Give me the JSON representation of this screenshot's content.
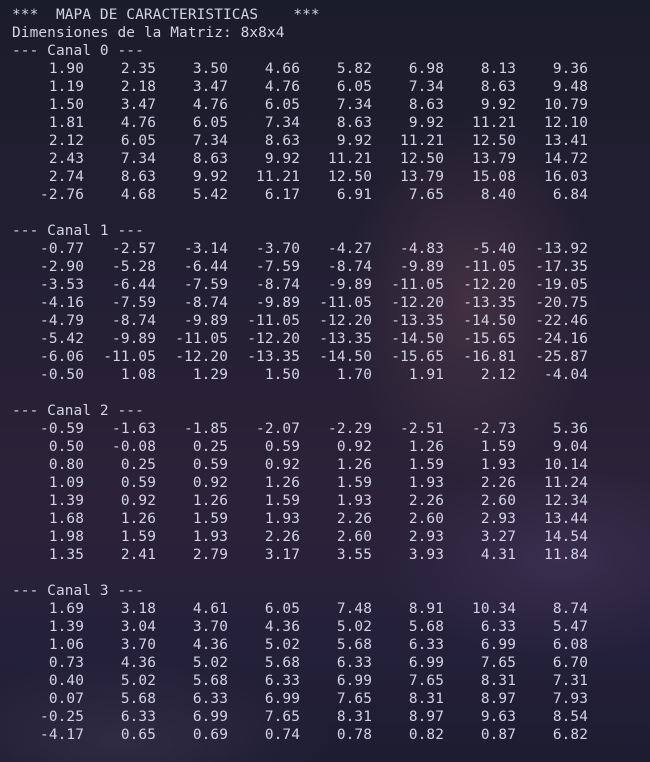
{
  "header": {
    "title_line": "***  MAPA DE CARACTERISTICAS    ***",
    "dims_line": "Dimensiones de la Matriz: 8x8x4"
  },
  "channels": [
    {
      "label": "--- Canal 0 ---",
      "rows": [
        [
          "1.90",
          "2.35",
          "3.50",
          "4.66",
          "5.82",
          "6.98",
          "8.13",
          "9.36"
        ],
        [
          "1.19",
          "2.18",
          "3.47",
          "4.76",
          "6.05",
          "7.34",
          "8.63",
          "9.48"
        ],
        [
          "1.50",
          "3.47",
          "4.76",
          "6.05",
          "7.34",
          "8.63",
          "9.92",
          "10.79"
        ],
        [
          "1.81",
          "4.76",
          "6.05",
          "7.34",
          "8.63",
          "9.92",
          "11.21",
          "12.10"
        ],
        [
          "2.12",
          "6.05",
          "7.34",
          "8.63",
          "9.92",
          "11.21",
          "12.50",
          "13.41"
        ],
        [
          "2.43",
          "7.34",
          "8.63",
          "9.92",
          "11.21",
          "12.50",
          "13.79",
          "14.72"
        ],
        [
          "2.74",
          "8.63",
          "9.92",
          "11.21",
          "12.50",
          "13.79",
          "15.08",
          "16.03"
        ],
        [
          "-2.76",
          "4.68",
          "5.42",
          "6.17",
          "6.91",
          "7.65",
          "8.40",
          "6.84"
        ]
      ]
    },
    {
      "label": "--- Canal 1 ---",
      "rows": [
        [
          "-0.77",
          "-2.57",
          "-3.14",
          "-3.70",
          "-4.27",
          "-4.83",
          "-5.40",
          "-13.92"
        ],
        [
          "-2.90",
          "-5.28",
          "-6.44",
          "-7.59",
          "-8.74",
          "-9.89",
          "-11.05",
          "-17.35"
        ],
        [
          "-3.53",
          "-6.44",
          "-7.59",
          "-8.74",
          "-9.89",
          "-11.05",
          "-12.20",
          "-19.05"
        ],
        [
          "-4.16",
          "-7.59",
          "-8.74",
          "-9.89",
          "-11.05",
          "-12.20",
          "-13.35",
          "-20.75"
        ],
        [
          "-4.79",
          "-8.74",
          "-9.89",
          "-11.05",
          "-12.20",
          "-13.35",
          "-14.50",
          "-22.46"
        ],
        [
          "-5.42",
          "-9.89",
          "-11.05",
          "-12.20",
          "-13.35",
          "-14.50",
          "-15.65",
          "-24.16"
        ],
        [
          "-6.06",
          "-11.05",
          "-12.20",
          "-13.35",
          "-14.50",
          "-15.65",
          "-16.81",
          "-25.87"
        ],
        [
          "-0.50",
          "1.08",
          "1.29",
          "1.50",
          "1.70",
          "1.91",
          "2.12",
          "-4.04"
        ]
      ]
    },
    {
      "label": "--- Canal 2 ---",
      "rows": [
        [
          "-0.59",
          "-1.63",
          "-1.85",
          "-2.07",
          "-2.29",
          "-2.51",
          "-2.73",
          "5.36"
        ],
        [
          "0.50",
          "-0.08",
          "0.25",
          "0.59",
          "0.92",
          "1.26",
          "1.59",
          "9.04"
        ],
        [
          "0.80",
          "0.25",
          "0.59",
          "0.92",
          "1.26",
          "1.59",
          "1.93",
          "10.14"
        ],
        [
          "1.09",
          "0.59",
          "0.92",
          "1.26",
          "1.59",
          "1.93",
          "2.26",
          "11.24"
        ],
        [
          "1.39",
          "0.92",
          "1.26",
          "1.59",
          "1.93",
          "2.26",
          "2.60",
          "12.34"
        ],
        [
          "1.68",
          "1.26",
          "1.59",
          "1.93",
          "2.26",
          "2.60",
          "2.93",
          "13.44"
        ],
        [
          "1.98",
          "1.59",
          "1.93",
          "2.26",
          "2.60",
          "2.93",
          "3.27",
          "14.54"
        ],
        [
          "1.35",
          "2.41",
          "2.79",
          "3.17",
          "3.55",
          "3.93",
          "4.31",
          "11.84"
        ]
      ]
    },
    {
      "label": "--- Canal 3 ---",
      "rows": [
        [
          "1.69",
          "3.18",
          "4.61",
          "6.05",
          "7.48",
          "8.91",
          "10.34",
          "8.74"
        ],
        [
          "1.39",
          "3.04",
          "3.70",
          "4.36",
          "5.02",
          "5.68",
          "6.33",
          "5.47"
        ],
        [
          "1.06",
          "3.70",
          "4.36",
          "5.02",
          "5.68",
          "6.33",
          "6.99",
          "6.08"
        ],
        [
          "0.73",
          "4.36",
          "5.02",
          "5.68",
          "6.33",
          "6.99",
          "7.65",
          "6.70"
        ],
        [
          "0.40",
          "5.02",
          "5.68",
          "6.33",
          "6.99",
          "7.65",
          "8.31",
          "7.31"
        ],
        [
          "0.07",
          "5.68",
          "6.33",
          "6.99",
          "7.65",
          "8.31",
          "8.97",
          "7.93"
        ],
        [
          "-0.25",
          "6.33",
          "6.99",
          "7.65",
          "8.31",
          "8.97",
          "9.63",
          "8.54"
        ],
        [
          "-4.17",
          "0.65",
          "0.69",
          "0.74",
          "0.78",
          "0.82",
          "0.87",
          "6.82"
        ]
      ]
    }
  ]
}
